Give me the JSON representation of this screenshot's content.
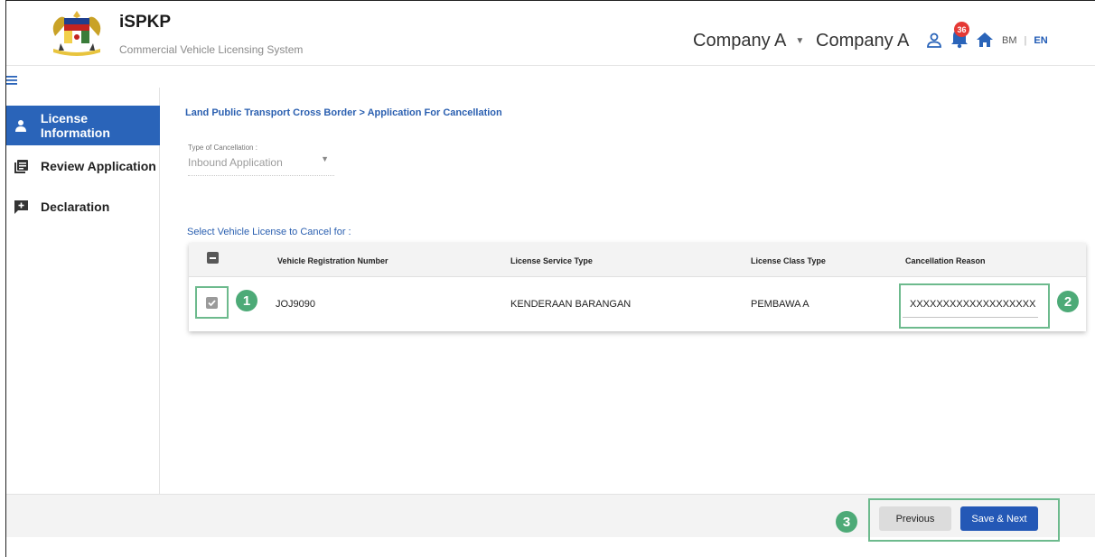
{
  "header": {
    "app_title": "iSPKP",
    "app_subtitle": "Commercial Vehicle Licensing System",
    "company_selector": "Company A",
    "company_name": "Company A",
    "notification_count": "36",
    "lang_bm": "BM",
    "lang_sep": "|",
    "lang_en": "EN"
  },
  "sidebar": {
    "items": [
      {
        "label": "License Information",
        "icon": "person-icon",
        "active": true
      },
      {
        "label": "Review Application",
        "icon": "document-list-icon",
        "active": false
      },
      {
        "label": "Declaration",
        "icon": "add-comment-icon",
        "active": false
      }
    ]
  },
  "main": {
    "breadcrumb": "Land Public Transport Cross Border > Application For Cancellation",
    "cancellation_type": {
      "label": "Type of Cancellation :",
      "value": "Inbound Application"
    },
    "select_label": "Select Vehicle License to Cancel for :",
    "table": {
      "headers": [
        "Vehicle Registration Number",
        "License Service Type",
        "License Class Type",
        "Cancellation Reason"
      ],
      "rows": [
        {
          "checked": true,
          "registration": "JOJ9090",
          "service_type": "KENDERAAN BARANGAN",
          "class_type": "PEMBAWA A",
          "reason": "XXXXXXXXXXXXXXXXXXX"
        }
      ]
    }
  },
  "annotations": {
    "step1": "1",
    "step2": "2",
    "step3": "3"
  },
  "footer": {
    "previous_label": "Previous",
    "save_next_label": "Save & Next"
  },
  "colors": {
    "primary": "#2a64b9",
    "annotation_green": "#4daa77",
    "badge_red": "#e53935"
  }
}
